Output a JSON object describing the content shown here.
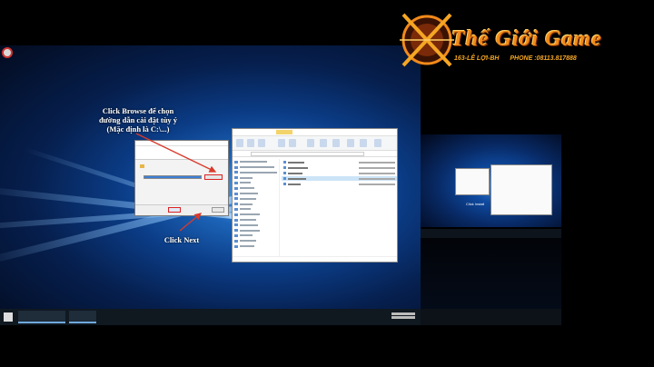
{
  "callouts": {
    "browse": [
      "Click Browse để chọn",
      "đường dẫn cài đặt tùy ý",
      "(Mặc định là C:\\...)"
    ],
    "next": "Click Next"
  },
  "logo": {
    "title": "Thế Giới Game",
    "subtitle": "163-LÊ LỢI-BH",
    "phone": "PHONE :08113.817888",
    "accent": "#f18a1a"
  },
  "colors": {
    "arrow": "#d93a2b",
    "browse_highlight": "#dd2222",
    "selection": "#cce4f7"
  },
  "mini_preview": {
    "caption": "Click Install"
  }
}
